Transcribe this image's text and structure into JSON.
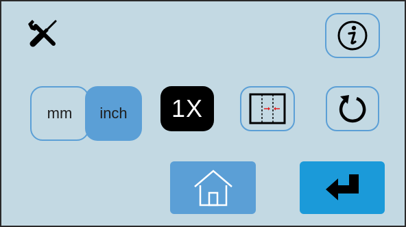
{
  "toolbar": {
    "settings_icon": "wrench-screwdriver-icon",
    "info_icon": "info-icon"
  },
  "units": {
    "options": [
      "mm",
      "inch"
    ],
    "selected": "inch"
  },
  "zoom": {
    "label": "1X"
  },
  "actions": {
    "split_icon": "split-panel-icon",
    "reset_icon": "rotate-reset-icon",
    "home_icon": "home-icon",
    "enter_icon": "enter-arrow-icon"
  },
  "colors": {
    "panel_bg": "#c3d9e3",
    "accent_blue": "#5b9fd6",
    "enter_blue": "#1b9ad9",
    "zoom_bg": "#000000"
  }
}
